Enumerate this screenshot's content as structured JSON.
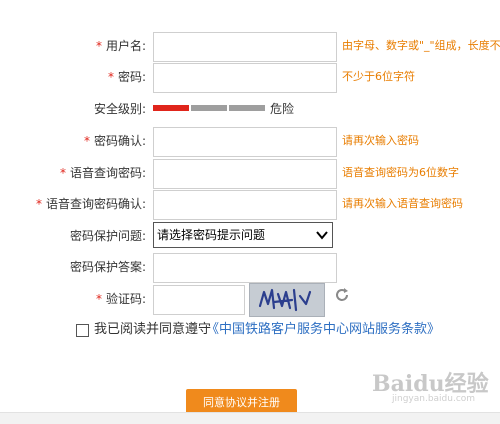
{
  "form": {
    "required_mark": "*",
    "username": {
      "label": "用户名:",
      "value": "",
      "hint": "由字母、数字或\"_\"组成，长度不少"
    },
    "password": {
      "label": "密码:",
      "value": "",
      "hint": "不少于6位字符"
    },
    "security_level": {
      "label": "安全级别:",
      "text": "危险",
      "level_fraction": 0.33,
      "colors": {
        "active": "#e0251b",
        "inactive": "#9e9e9e"
      }
    },
    "confirm_password": {
      "label": "密码确认:",
      "value": "",
      "hint": "请再次输入密码"
    },
    "voice_password": {
      "label": "语音查询密码:",
      "value": "",
      "hint": "语音查询密码为6位数字"
    },
    "voice_password_confirm": {
      "label": "语音查询密码确认:",
      "value": "",
      "hint": "请再次输入语音查询密码"
    },
    "security_question": {
      "label": "密码保护问题:",
      "selected": "请选择密码提示问题"
    },
    "security_answer": {
      "label": "密码保护答案:",
      "value": ""
    },
    "captcha": {
      "label": "验证码:",
      "value": "",
      "refresh_icon": "refresh-icon"
    }
  },
  "agreement": {
    "text": "我已阅读并同意遵守",
    "link": "《中国铁路客户服务中心网站服务条款》",
    "checked": false
  },
  "submit_label": "同意协议并注册",
  "watermark": {
    "main": "Baidu经验",
    "sub": "jingyan.baidu.com"
  },
  "colors": {
    "hint": "#e87d00",
    "required": "#e0251b",
    "link": "#2e6fc2",
    "button": "#f08a1c"
  }
}
